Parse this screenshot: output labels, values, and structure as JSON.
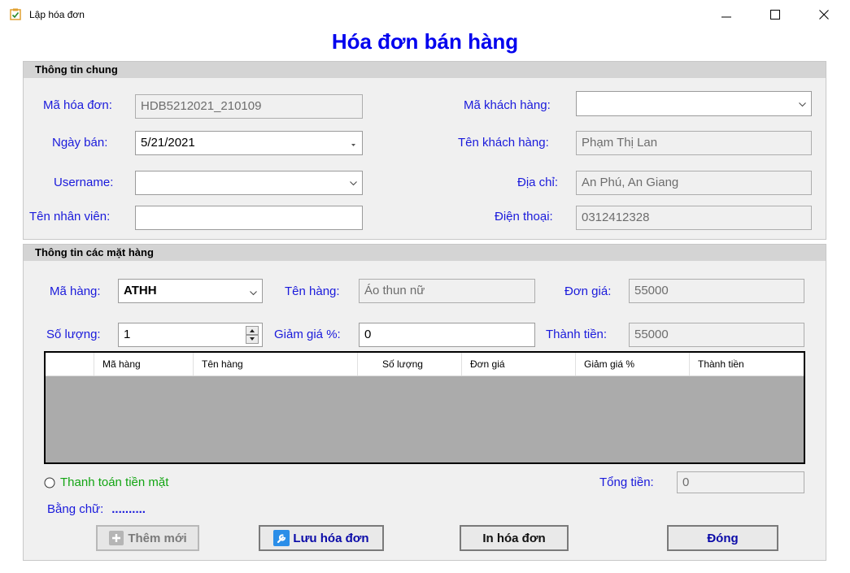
{
  "window": {
    "title": "Lập hóa đơn"
  },
  "heading": "Hóa đơn bán hàng",
  "general": {
    "header": "Thông tin chung",
    "invoice_id_label": "Mã hóa đơn:",
    "invoice_id_value": "HDB5212021_210109",
    "sale_date_label": "Ngày bán:",
    "sale_date_value": "5/21/2021",
    "username_label": "Username:",
    "username_value": "",
    "employee_name_label": "Tên nhân viên:",
    "employee_name_value": "",
    "customer_id_label": "Mã khách hàng:",
    "customer_id_value": "",
    "customer_name_label": "Tên khách hàng:",
    "customer_name_value": "Phạm Thị Lan",
    "address_label": "Địa chỉ:",
    "address_value": "An Phú, An Giang",
    "phone_label": "Điện thoại:",
    "phone_value": "0312412328"
  },
  "items": {
    "header": "Thông tin các mặt hàng",
    "item_code_label": "Mã hàng:",
    "item_code_value": "ATHH",
    "item_name_label": "Tên hàng:",
    "item_name_value": "Áo thun nữ",
    "unit_price_label": "Đơn giá:",
    "unit_price_value": "55000",
    "quantity_label": "Số lượng:",
    "quantity_value": "1",
    "discount_label": "Giảm giá %:",
    "discount_value": "0",
    "line_total_label": "Thành tiền:",
    "line_total_value": "55000",
    "columns": [
      "Mã hàng",
      "Tên hàng",
      "Số lượng",
      "Đơn giá",
      "Giảm giá %",
      "Thành tiền"
    ],
    "cash_payment_label": "Thanh toán tiền mặt",
    "total_label": "Tổng tiền:",
    "total_value": "0",
    "in_words_label": "Bằng chữ:",
    "in_words_value": ".........."
  },
  "buttons": {
    "add_new": "Thêm mới",
    "save": "Lưu hóa đơn",
    "print": "In hóa đơn",
    "close": "Đóng"
  },
  "colors": {
    "label_blue": "#1a1adb",
    "heading_blue": "#0000ee",
    "cash_green": "#13a513"
  }
}
